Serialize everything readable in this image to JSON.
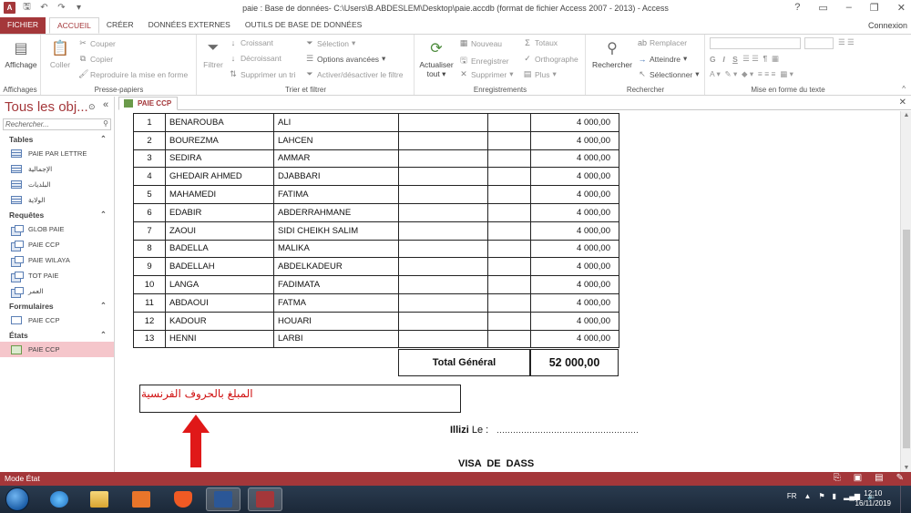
{
  "window": {
    "title": "paie : Base de données- C:\\Users\\B.ABDESLEM\\Desktop\\paie.accdb (format de fichier Access 2007 - 2013) - Access",
    "help": "?",
    "connexion": "Connexion"
  },
  "ribbon_tabs": [
    "FICHIER",
    "ACCUEIL",
    "CRÉER",
    "DONNÉES EXTERNES",
    "OUTILS DE BASE DE DONNÉES"
  ],
  "ribbon": {
    "affichages": {
      "affichage": "Affichage",
      "group": "Affichages"
    },
    "presse": {
      "coller": "Coller",
      "couper": "Couper",
      "copier": "Copier",
      "reproduire": "Reproduire la mise en forme",
      "group": "Presse-papiers"
    },
    "trier": {
      "filtrer": "Filtrer",
      "croissant": "Croissant",
      "decroissant": "Décroissant",
      "supprimer_tri": "Supprimer un tri",
      "selection": "Sélection",
      "options": "Options avancées",
      "activer": "Activer/désactiver le filtre",
      "group": "Trier et filtrer"
    },
    "enreg": {
      "actualiser": "Actualiser",
      "tout": "tout",
      "nouveau": "Nouveau",
      "enregistrer": "Enregistrer",
      "supprimer": "Supprimer",
      "totaux": "Totaux",
      "orthographe": "Orthographe",
      "plus": "Plus",
      "group": "Enregistrements"
    },
    "rechercher": {
      "rechercher": "Rechercher",
      "remplacer": "Remplacer",
      "atteindre": "Atteindre",
      "selectionner": "Sélectionner",
      "group": "Rechercher"
    },
    "texte": {
      "group": "Mise en forme du texte"
    }
  },
  "nav": {
    "title": "Tous les obj...",
    "search_placeholder": "Rechercher...",
    "categories": [
      {
        "name": "Tables",
        "items": [
          "PAIE PAR LETTRE",
          "الإجمالية",
          "البلديات",
          "الولاية"
        ]
      },
      {
        "name": "Requêtes",
        "items": [
          "GLOB PAIE",
          "PAIE CCP",
          "PAIE WILAYA",
          "TOT PAIE",
          "العمر"
        ]
      },
      {
        "name": "Formulaires",
        "items": [
          "PAIE CCP"
        ]
      },
      {
        "name": "États",
        "items": [
          "PAIE CCP"
        ]
      }
    ]
  },
  "doc_tab": "PAIE CCP",
  "report": {
    "rows": [
      [
        "1",
        "BENAROUBA",
        "ALI",
        "4 000,00"
      ],
      [
        "2",
        "BOUREZMA",
        "LAHCEN",
        "4 000,00"
      ],
      [
        "3",
        "SEDIRA",
        "AMMAR",
        "4 000,00"
      ],
      [
        "4",
        "GHEDAIR AHMED",
        "DJABBARI",
        "4 000,00"
      ],
      [
        "5",
        "MAHAMEDI",
        "FATIMA",
        "4 000,00"
      ],
      [
        "6",
        "EDABIR",
        "ABDERRAHMANE",
        "4 000,00"
      ],
      [
        "7",
        "ZAOUI",
        "SIDI CHEIKH SALIM",
        "4 000,00"
      ],
      [
        "8",
        "BADELLA",
        "MALIKA",
        "4 000,00"
      ],
      [
        "9",
        "BADELLAH",
        "ABDELKADEUR",
        "4 000,00"
      ],
      [
        "10",
        "LANGA",
        "FADIMATA",
        "4 000,00"
      ],
      [
        "11",
        "ABDAOUI",
        "FATMA",
        "4 000,00"
      ],
      [
        "12",
        "KADOUR",
        "HOUARI",
        "4 000,00"
      ],
      [
        "13",
        "HENNI",
        "LARBI",
        "4 000,00"
      ]
    ],
    "total_label": "Total Général",
    "total_value": "52 000,00",
    "amount_in_words": "المبلغ بالحروف الفرنسية",
    "place": "Illizi",
    "le": "Le :",
    "dots": "....................................................",
    "visa": "VISA  DE  DASS",
    "annotation_color": "#d01010"
  },
  "status": {
    "mode": "Mode État"
  },
  "taskbar": {
    "lang": "FR",
    "time": "12:10",
    "date": "16/11/2019"
  },
  "colors": {
    "accent": "#a4373a",
    "selected_nav": "#f5c6cb"
  }
}
